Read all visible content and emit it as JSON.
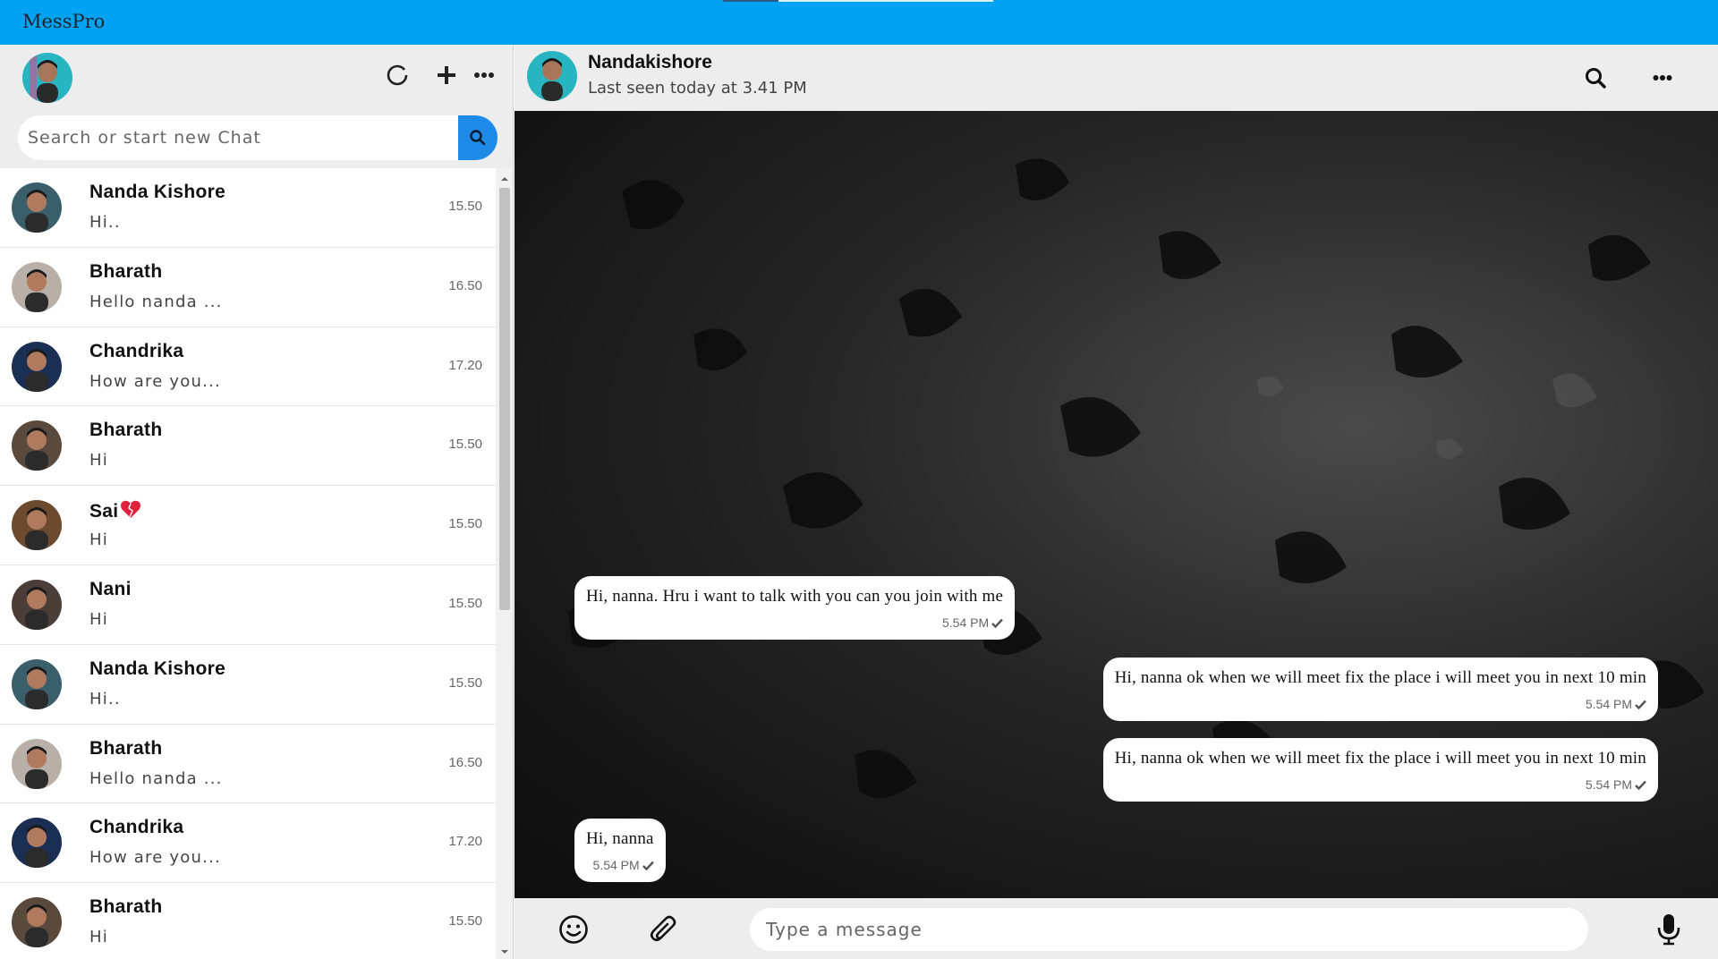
{
  "app": {
    "title": "MessPro"
  },
  "sidebar": {
    "search_placeholder": "Search or start new Chat",
    "tools": [
      "refresh-icon",
      "plus-icon",
      "more-icon"
    ],
    "chats": [
      {
        "name": "Nanda Kishore",
        "message": "Hi..",
        "time": "15.50",
        "avatar_color": "#3a5f6a"
      },
      {
        "name": "Bharath",
        "message": "Hello nanda ...",
        "time": "16.50",
        "avatar_color": "#b8b0a8"
      },
      {
        "name": "Chandrika",
        "message": "How are you...",
        "time": "17.20",
        "avatar_color": "#1b2f55"
      },
      {
        "name": "Bharath",
        "message": "Hi",
        "time": "15.50",
        "avatar_color": "#5a4a3e"
      },
      {
        "name": "Sai",
        "message": "Hi",
        "time": "15.50",
        "avatar_color": "#6b4a2e",
        "emoji": "heart-icon"
      },
      {
        "name": "Nani",
        "message": "Hi",
        "time": "15.50",
        "avatar_color": "#4b3e38"
      },
      {
        "name": "Nanda Kishore",
        "message": "Hi..",
        "time": "15.50",
        "avatar_color": "#3a5f6a"
      },
      {
        "name": "Bharath",
        "message": "Hello nanda ...",
        "time": "16.50",
        "avatar_color": "#b8b0a8"
      },
      {
        "name": "Chandrika",
        "message": "How are you...",
        "time": "17.20",
        "avatar_color": "#1b2f55"
      },
      {
        "name": "Bharath",
        "message": "Hi",
        "time": "15.50",
        "avatar_color": "#5a4a3e"
      }
    ]
  },
  "conversation": {
    "contact_name": "Nandakishore",
    "status": "Last seen today at 3.41 PM",
    "messages": [
      {
        "text": "Hi, nanna. Hru i want to talk with you can you join with me",
        "time": "5.54 PM",
        "direction": "incoming"
      },
      {
        "text": "Hi, nanna ok when we will meet fix the place i will meet you in next 10 min",
        "time": "5.54 PM",
        "direction": "outgoing"
      },
      {
        "text": "Hi, nanna ok when we will meet fix the place i will meet you in next 10 min",
        "time": "5.54 PM",
        "direction": "outgoing"
      },
      {
        "text": "Hi, nanna",
        "time": "5.54 PM",
        "direction": "incoming"
      }
    ],
    "input_placeholder": "Type a message"
  },
  "colors": {
    "topbar": "#00a2f2",
    "search_button": "#1e8be8",
    "panel": "#ededed"
  }
}
